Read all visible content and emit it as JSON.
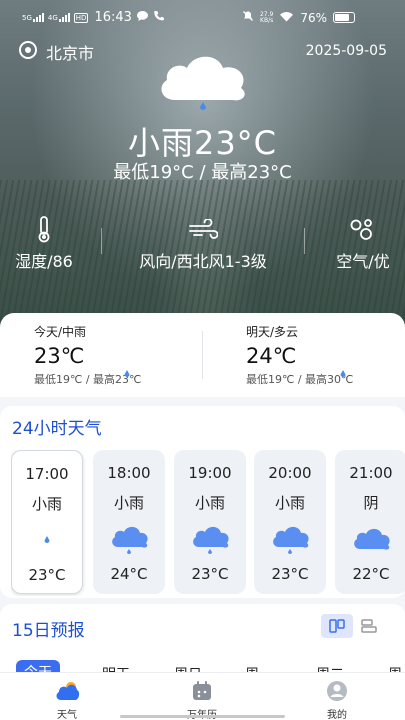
{
  "status_bar": {
    "net1": "5G",
    "net2": "4G",
    "hd": "HD",
    "time": "16:43",
    "speed_value": "27.9",
    "speed_unit": "KB/s",
    "battery": "76%"
  },
  "location": {
    "city": "北京市",
    "date": "2025-09-05"
  },
  "current": {
    "condition_temp": "小雨23°C",
    "range": "最低19°C  /  最高23°C"
  },
  "metrics": [
    {
      "label": "湿度/86",
      "icon": "thermometer-icon"
    },
    {
      "label": "风向/西北风1-3级",
      "icon": "wind-icon"
    },
    {
      "label": "空气/优",
      "icon": "air-quality-icon"
    }
  ],
  "today": {
    "label": "今天/中雨",
    "temp": "23℃",
    "range": "最低19℃ / 最高23℃"
  },
  "tomorrow": {
    "label": "明天/多云",
    "temp": "24℃",
    "range": "最低19℃ / 最高30℃"
  },
  "hourly": {
    "title": "24小时天气",
    "items": [
      {
        "time": "17:00",
        "cond": "小雨",
        "temp": "23°C",
        "icon": "rain-drop-icon"
      },
      {
        "time": "18:00",
        "cond": "小雨",
        "temp": "24°C",
        "icon": "cloud-rain-icon"
      },
      {
        "time": "19:00",
        "cond": "小雨",
        "temp": "23°C",
        "icon": "cloud-rain-icon"
      },
      {
        "time": "20:00",
        "cond": "小雨",
        "temp": "23°C",
        "icon": "cloud-rain-icon"
      },
      {
        "time": "21:00",
        "cond": "阴",
        "temp": "22°C",
        "icon": "cloud-icon"
      }
    ]
  },
  "forecast": {
    "title": "15日预报",
    "days": [
      "今天",
      "明天",
      "周日",
      "周一",
      "周二",
      "周"
    ]
  },
  "nav": [
    {
      "label": "天气",
      "icon": "weather-icon"
    },
    {
      "label": "万年历",
      "icon": "calendar-icon"
    },
    {
      "label": "我的",
      "icon": "profile-icon"
    }
  ],
  "colors": {
    "accent": "#1d4fd3",
    "cloud_blue": "#5a8ef0",
    "selected_day": "#3a6df0"
  }
}
